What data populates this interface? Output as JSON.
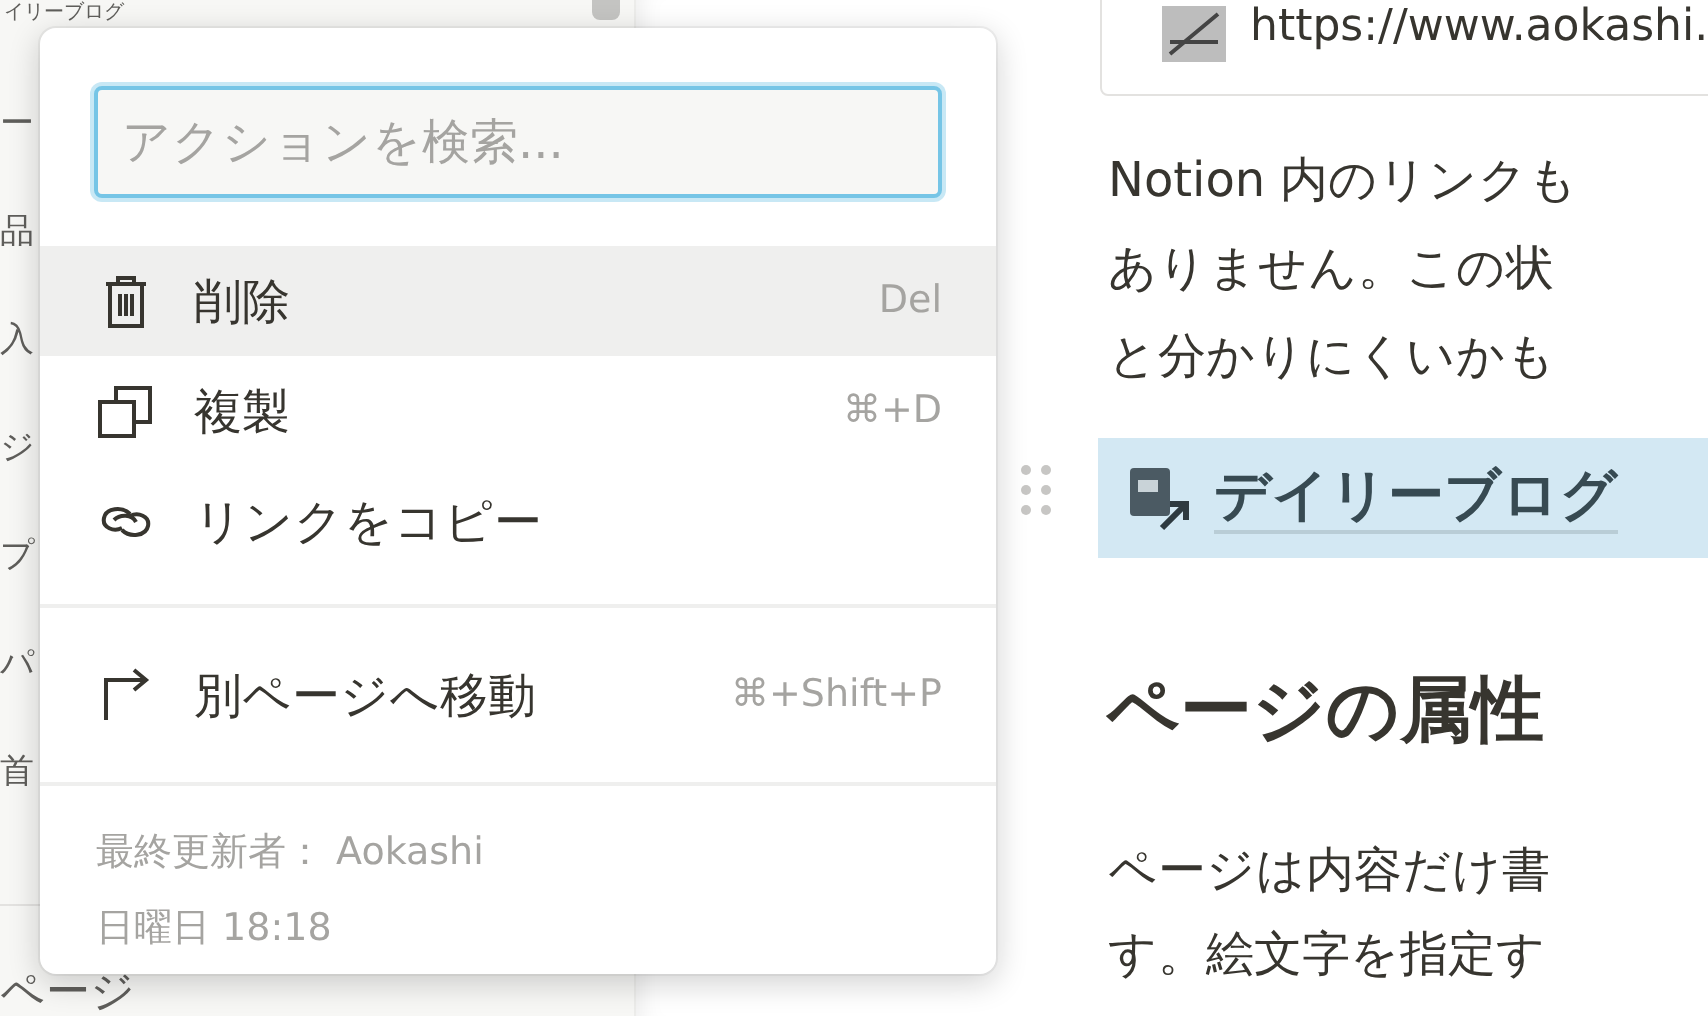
{
  "sidebar": {
    "title": "イリーブログ",
    "fragments": [
      "ー",
      "品",
      "入",
      "ジ",
      "プ",
      "パ",
      "首"
    ],
    "bottom": "ページ"
  },
  "menu": {
    "search": {
      "placeholder": "アクションを検索..."
    },
    "groups": [
      [
        {
          "kind": "trash",
          "label": "削除",
          "shortcut": "Del",
          "selected": true
        },
        {
          "kind": "duplicate",
          "label": "複製",
          "shortcut": "⌘+D",
          "selected": false
        },
        {
          "kind": "link",
          "label": "リンクをコピー",
          "selected": false
        }
      ],
      [
        {
          "kind": "move",
          "label": "別ページへ移動",
          "shortcut": "⌘+Shift+P",
          "selected": false
        }
      ]
    ],
    "footer": [
      "最終更新者： Aokashi",
      "日曜日 18:18"
    ]
  },
  "content": {
    "bookmark_url": "https://www.aokashi.",
    "paragraph_1": [
      "Notion 内のリンクも",
      "ありません。この状",
      "と分かりにくいかも"
    ],
    "page_link": {
      "title": "デイリーブログ",
      "selected": true
    },
    "heading": "ページの属性",
    "paragraph_2": [
      "ページは内容だけ書",
      "す。絵文字を指定す"
    ]
  }
}
